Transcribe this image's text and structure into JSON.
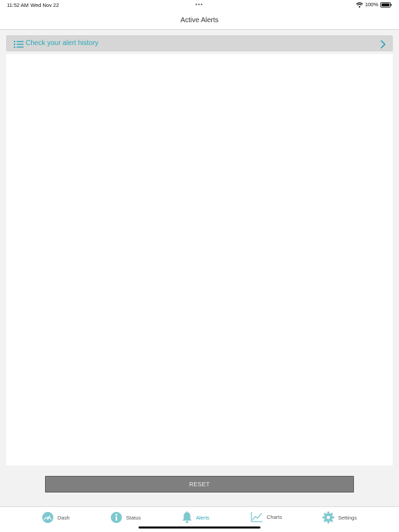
{
  "status_bar": {
    "time": "11:52 AM",
    "date": "Wed Nov 22",
    "dots": "•••",
    "battery": "100%"
  },
  "nav": {
    "title": "Active Alerts"
  },
  "history": {
    "label": "Check your alert history",
    "icon": "list-icon"
  },
  "reset": {
    "label": "RESET"
  },
  "tabs": [
    {
      "label": "Dash",
      "icon": "dash-gauge-icon"
    },
    {
      "label": "Status",
      "icon": "info-icon"
    },
    {
      "label": "Alerts",
      "icon": "bell-icon",
      "active": true
    },
    {
      "label": "Charts",
      "icon": "line-chart-icon"
    },
    {
      "label": "Settings",
      "icon": "gear-icon"
    }
  ],
  "colors": {
    "accent": "#2aa6b8",
    "icon_teal": "#7fc8cf",
    "reset_bg": "#7f7f7f"
  }
}
